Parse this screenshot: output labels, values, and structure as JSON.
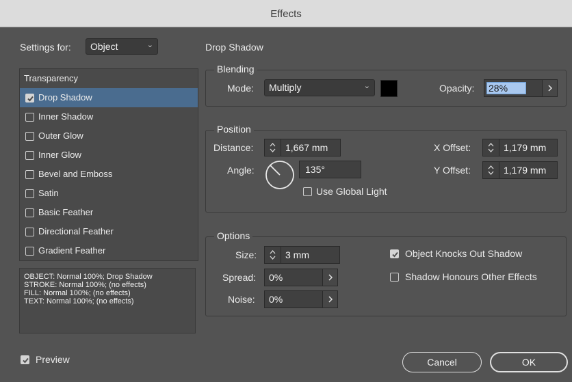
{
  "window": {
    "title": "Effects"
  },
  "settings": {
    "label": "Settings for:",
    "value": "Object"
  },
  "list": {
    "header": "Transparency",
    "items": [
      {
        "label": "Drop Shadow",
        "checked": true,
        "selected": true
      },
      {
        "label": "Inner Shadow",
        "checked": false
      },
      {
        "label": "Outer Glow",
        "checked": false
      },
      {
        "label": "Inner Glow",
        "checked": false
      },
      {
        "label": "Bevel and Emboss",
        "checked": false
      },
      {
        "label": "Satin",
        "checked": false
      },
      {
        "label": "Basic Feather",
        "checked": false
      },
      {
        "label": "Directional Feather",
        "checked": false
      },
      {
        "label": "Gradient Feather",
        "checked": false
      }
    ]
  },
  "summary": [
    "OBJECT: Normal 100%; Drop Shadow",
    "STROKE: Normal 100%; (no effects)",
    "FILL: Normal 100%; (no effects)",
    "TEXT: Normal 100%; (no effects)"
  ],
  "panel": {
    "title": "Drop Shadow"
  },
  "blending": {
    "legend": "Blending",
    "mode_label": "Mode:",
    "mode_value": "Multiply",
    "color": "#000000",
    "opacity_label": "Opacity:",
    "opacity_value": "28%"
  },
  "position": {
    "legend": "Position",
    "distance_label": "Distance:",
    "distance_value": "1,667 mm",
    "angle_label": "Angle:",
    "angle_value": "135°",
    "global_light_label": "Use Global Light",
    "global_light_checked": false,
    "xoffset_label": "X Offset:",
    "xoffset_value": "1,179 mm",
    "yoffset_label": "Y Offset:",
    "yoffset_value": "1,179 mm"
  },
  "options": {
    "legend": "Options",
    "size_label": "Size:",
    "size_value": "3 mm",
    "spread_label": "Spread:",
    "spread_value": "0%",
    "noise_label": "Noise:",
    "noise_value": "0%",
    "knocks_out_label": "Object Knocks Out Shadow",
    "knocks_out_checked": true,
    "honours_label": "Shadow Honours Other Effects",
    "honours_checked": false
  },
  "footer": {
    "preview_label": "Preview",
    "preview_checked": true,
    "cancel_label": "Cancel",
    "ok_label": "OK"
  },
  "icons": {
    "checkbox_check": "check-icon",
    "stepper": "stepper-icon",
    "arrow": "chevron-right-icon",
    "dropdown": "chevron-down-icon",
    "angle": "angle-dial-icon"
  }
}
